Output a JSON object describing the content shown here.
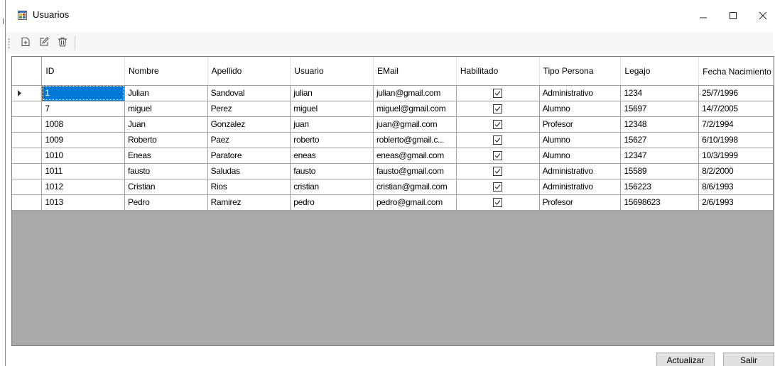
{
  "window": {
    "title": "Usuarios",
    "minimize_symbol": "—",
    "maximize_symbol": "☐",
    "close_symbol": "✕"
  },
  "toolbar": {
    "buttons": [
      {
        "name": "new-icon"
      },
      {
        "name": "edit-icon"
      },
      {
        "name": "delete-icon"
      }
    ]
  },
  "grid": {
    "columns": [
      "ID",
      "Nombre",
      "Apellido",
      "Usuario",
      "EMail",
      "Habilitado",
      "Tipo Persona",
      "Legajo",
      "Fecha Nacimiento"
    ],
    "rows": [
      {
        "id": "1",
        "nombre": "Julian",
        "apellido": "Sandoval",
        "usuario": "julian",
        "email": "julian@gmail.com",
        "habilitado": true,
        "tipo": "Administrativo",
        "legajo": "1234",
        "fecha": "25/7/1996"
      },
      {
        "id": "7",
        "nombre": "miguel",
        "apellido": "Perez",
        "usuario": "miguel",
        "email": "miguel@gmail.com",
        "habilitado": true,
        "tipo": "Alumno",
        "legajo": "15697",
        "fecha": "14/7/2005"
      },
      {
        "id": "1008",
        "nombre": "Juan",
        "apellido": "Gonzalez",
        "usuario": "juan",
        "email": "juan@gmail.com",
        "habilitado": true,
        "tipo": "Profesor",
        "legajo": "12348",
        "fecha": "7/2/1994"
      },
      {
        "id": "1009",
        "nombre": "Roberto",
        "apellido": "Paez",
        "usuario": "roberto",
        "email": "roblerto@gmail.c...",
        "habilitado": true,
        "tipo": "Alumno",
        "legajo": "15627",
        "fecha": "6/10/1998"
      },
      {
        "id": "1010",
        "nombre": "Eneas",
        "apellido": "Paratore",
        "usuario": "eneas",
        "email": "eneas@gmail.com",
        "habilitado": true,
        "tipo": "Alumno",
        "legajo": "12347",
        "fecha": "10/3/1999"
      },
      {
        "id": "1011",
        "nombre": "fausto",
        "apellido": "Saludas",
        "usuario": "fausto",
        "email": "fausto@gmail.com",
        "habilitado": true,
        "tipo": "Administrativo",
        "legajo": "15589",
        "fecha": "8/2/2000"
      },
      {
        "id": "1012",
        "nombre": "Cristian",
        "apellido": "Rios",
        "usuario": "cristian",
        "email": "cristian@gmail.com",
        "habilitado": true,
        "tipo": "Administrativo",
        "legajo": "156223",
        "fecha": "8/6/1993"
      },
      {
        "id": "1013",
        "nombre": "Pedro",
        "apellido": "Ramirez",
        "usuario": "pedro",
        "email": "pedro@gmail.com",
        "habilitado": true,
        "tipo": "Profesor",
        "legajo": "15698623",
        "fecha": "2/6/1993"
      }
    ],
    "selected_row": 0,
    "selection_color": "#0078d7",
    "empty_area_color": "#a9a9a9"
  },
  "footer": {
    "actualizar_label": "Actualizar",
    "salir_label": "Salir"
  }
}
